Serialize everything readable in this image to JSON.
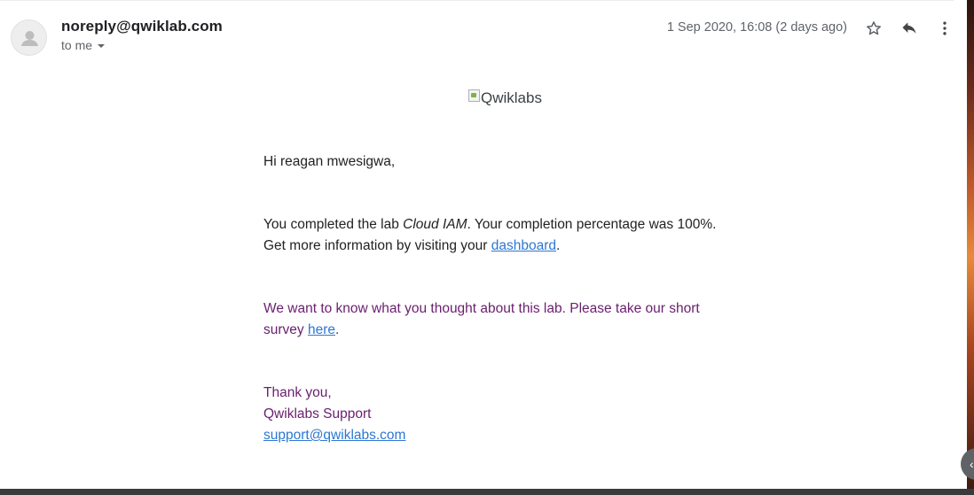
{
  "email": {
    "sender": "noreply@qwiklab.com",
    "recipient": "to me",
    "timestamp": "1 Sep 2020, 16:08 (2 days ago)"
  },
  "icons": {
    "avatar": "person-icon",
    "star": "star-icon",
    "reply": "reply-icon",
    "more": "more-vert-icon",
    "nav": "chevron-left-icon"
  },
  "message": {
    "logo_alt": "Qwiklabs",
    "greeting": "Hi reagan mwesigwa,",
    "completion_prefix": "You completed the lab ",
    "lab_name": "Cloud IAM",
    "completion_suffix": ". Your completion percentage was 100%.",
    "info_prefix": "Get more information by visiting your ",
    "dashboard_link": "dashboard",
    "info_suffix": ".",
    "survey_text": "We want to know what you thought about this lab. Please take our short survey ",
    "survey_link": "here",
    "survey_suffix": ".",
    "closing": "Thank you,",
    "signature": "Qwiklabs Support",
    "support_email": "support@qwiklabs.com"
  },
  "colors": {
    "link": "#2c77d3",
    "survey_text": "#6b2070",
    "secondary_text": "#5f6368"
  }
}
